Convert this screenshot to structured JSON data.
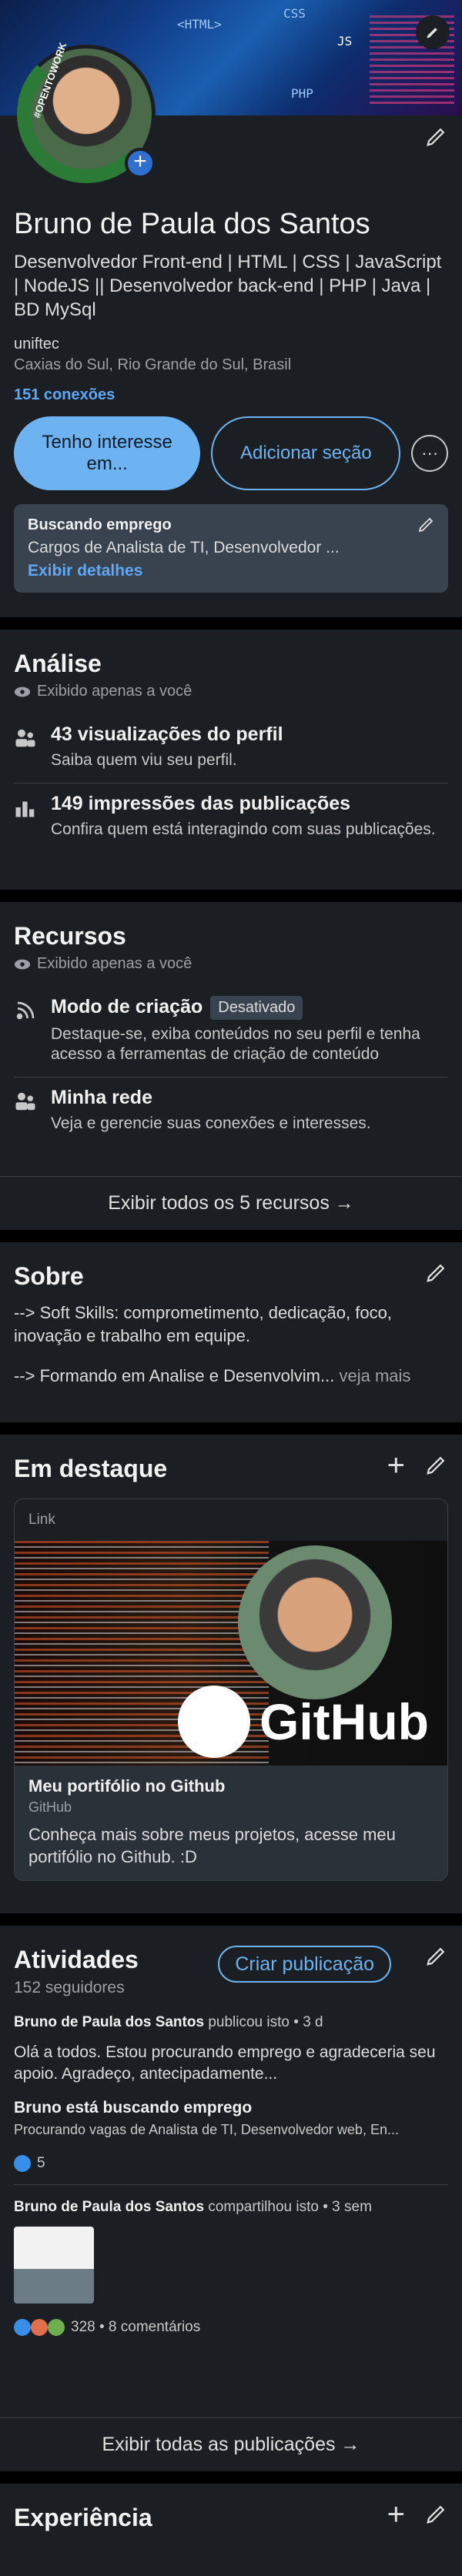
{
  "cover": {
    "code_text": "<HTML>",
    "css_text": "CSS",
    "php_text": "PHP",
    "js_text": "JS"
  },
  "avatar": {
    "frame_text": "#OPENTOWORK"
  },
  "profile": {
    "name": "Bruno de Paula dos Santos",
    "headline": "Desenvolvedor Front-end  | HTML | CSS | JavaScript | NodeJS || Desenvolvedor back-end | PHP |  Java | BD MySql",
    "education": "uniftec",
    "location": "Caxias do Sul, Rio Grande do Sul, Brasil",
    "connections": "151 conexões",
    "btn_interest": "Tenho interesse em...",
    "btn_add_section": "Adicionar seção",
    "btn_more": "···"
  },
  "open_to_work": {
    "title": "Buscando emprego",
    "details": "Cargos de Analista de TI, Desenvolvedor ...",
    "link": "Exibir detalhes"
  },
  "analytics": {
    "title": "Análise",
    "privacy": "Exibido apenas a você",
    "items": [
      {
        "title": "43 visualizações do perfil",
        "desc": "Saiba quem viu seu perfil."
      },
      {
        "title": "149 impressões das publicações",
        "desc": "Confira quem está interagindo com suas publicações."
      }
    ]
  },
  "resources": {
    "title": "Recursos",
    "privacy": "Exibido apenas a você",
    "items": [
      {
        "title": "Modo de criação",
        "badge": "Desativado",
        "desc": "Destaque-se, exiba conteúdos no seu perfil e tenha acesso a ferramentas de criação de conteúdo"
      },
      {
        "title": "Minha rede",
        "desc": "Veja e gerencie suas conexões e interesses."
      }
    ],
    "footer": "Exibir todos os 5 recursos →"
  },
  "about": {
    "title": "Sobre",
    "line1": "--> Soft Skills: comprometimento, dedicação, foco, inovação e trabalho em equipe.",
    "line2": "--> Formando em Analise e Desenvolvim...",
    "more": "veja mais"
  },
  "featured": {
    "title": "Em destaque",
    "add": "+",
    "card": {
      "label": "Link",
      "logo_text": "GitHub",
      "title": "Meu portifólio no Github",
      "source": "GitHub",
      "desc": "Conheça mais sobre meus projetos, acesse meu portifólio no Github. :D"
    }
  },
  "activity": {
    "title": "Atividades",
    "create_label": "Criar publicação",
    "followers": "152 seguidores",
    "posts": [
      {
        "author": "Bruno de Paula dos Santos",
        "action": " publicou isto • 3 d",
        "body": "Olá a todos. Estou procurando emprego e agradeceria seu apoio. Agradeço, antecipadamente...",
        "sub_title": "Bruno está buscando emprego",
        "sub_desc": "Procurando vagas de Analista de TI, Desenvolvedor web, En...",
        "reactions": "5"
      },
      {
        "author": "Bruno de Paula dos Santos",
        "action": " compartilhou isto • 3 sem",
        "reactions": "328 • 8 comentários"
      }
    ],
    "footer": "Exibir todas as publicações →"
  },
  "experience": {
    "title": "Experiência",
    "add": "+"
  }
}
